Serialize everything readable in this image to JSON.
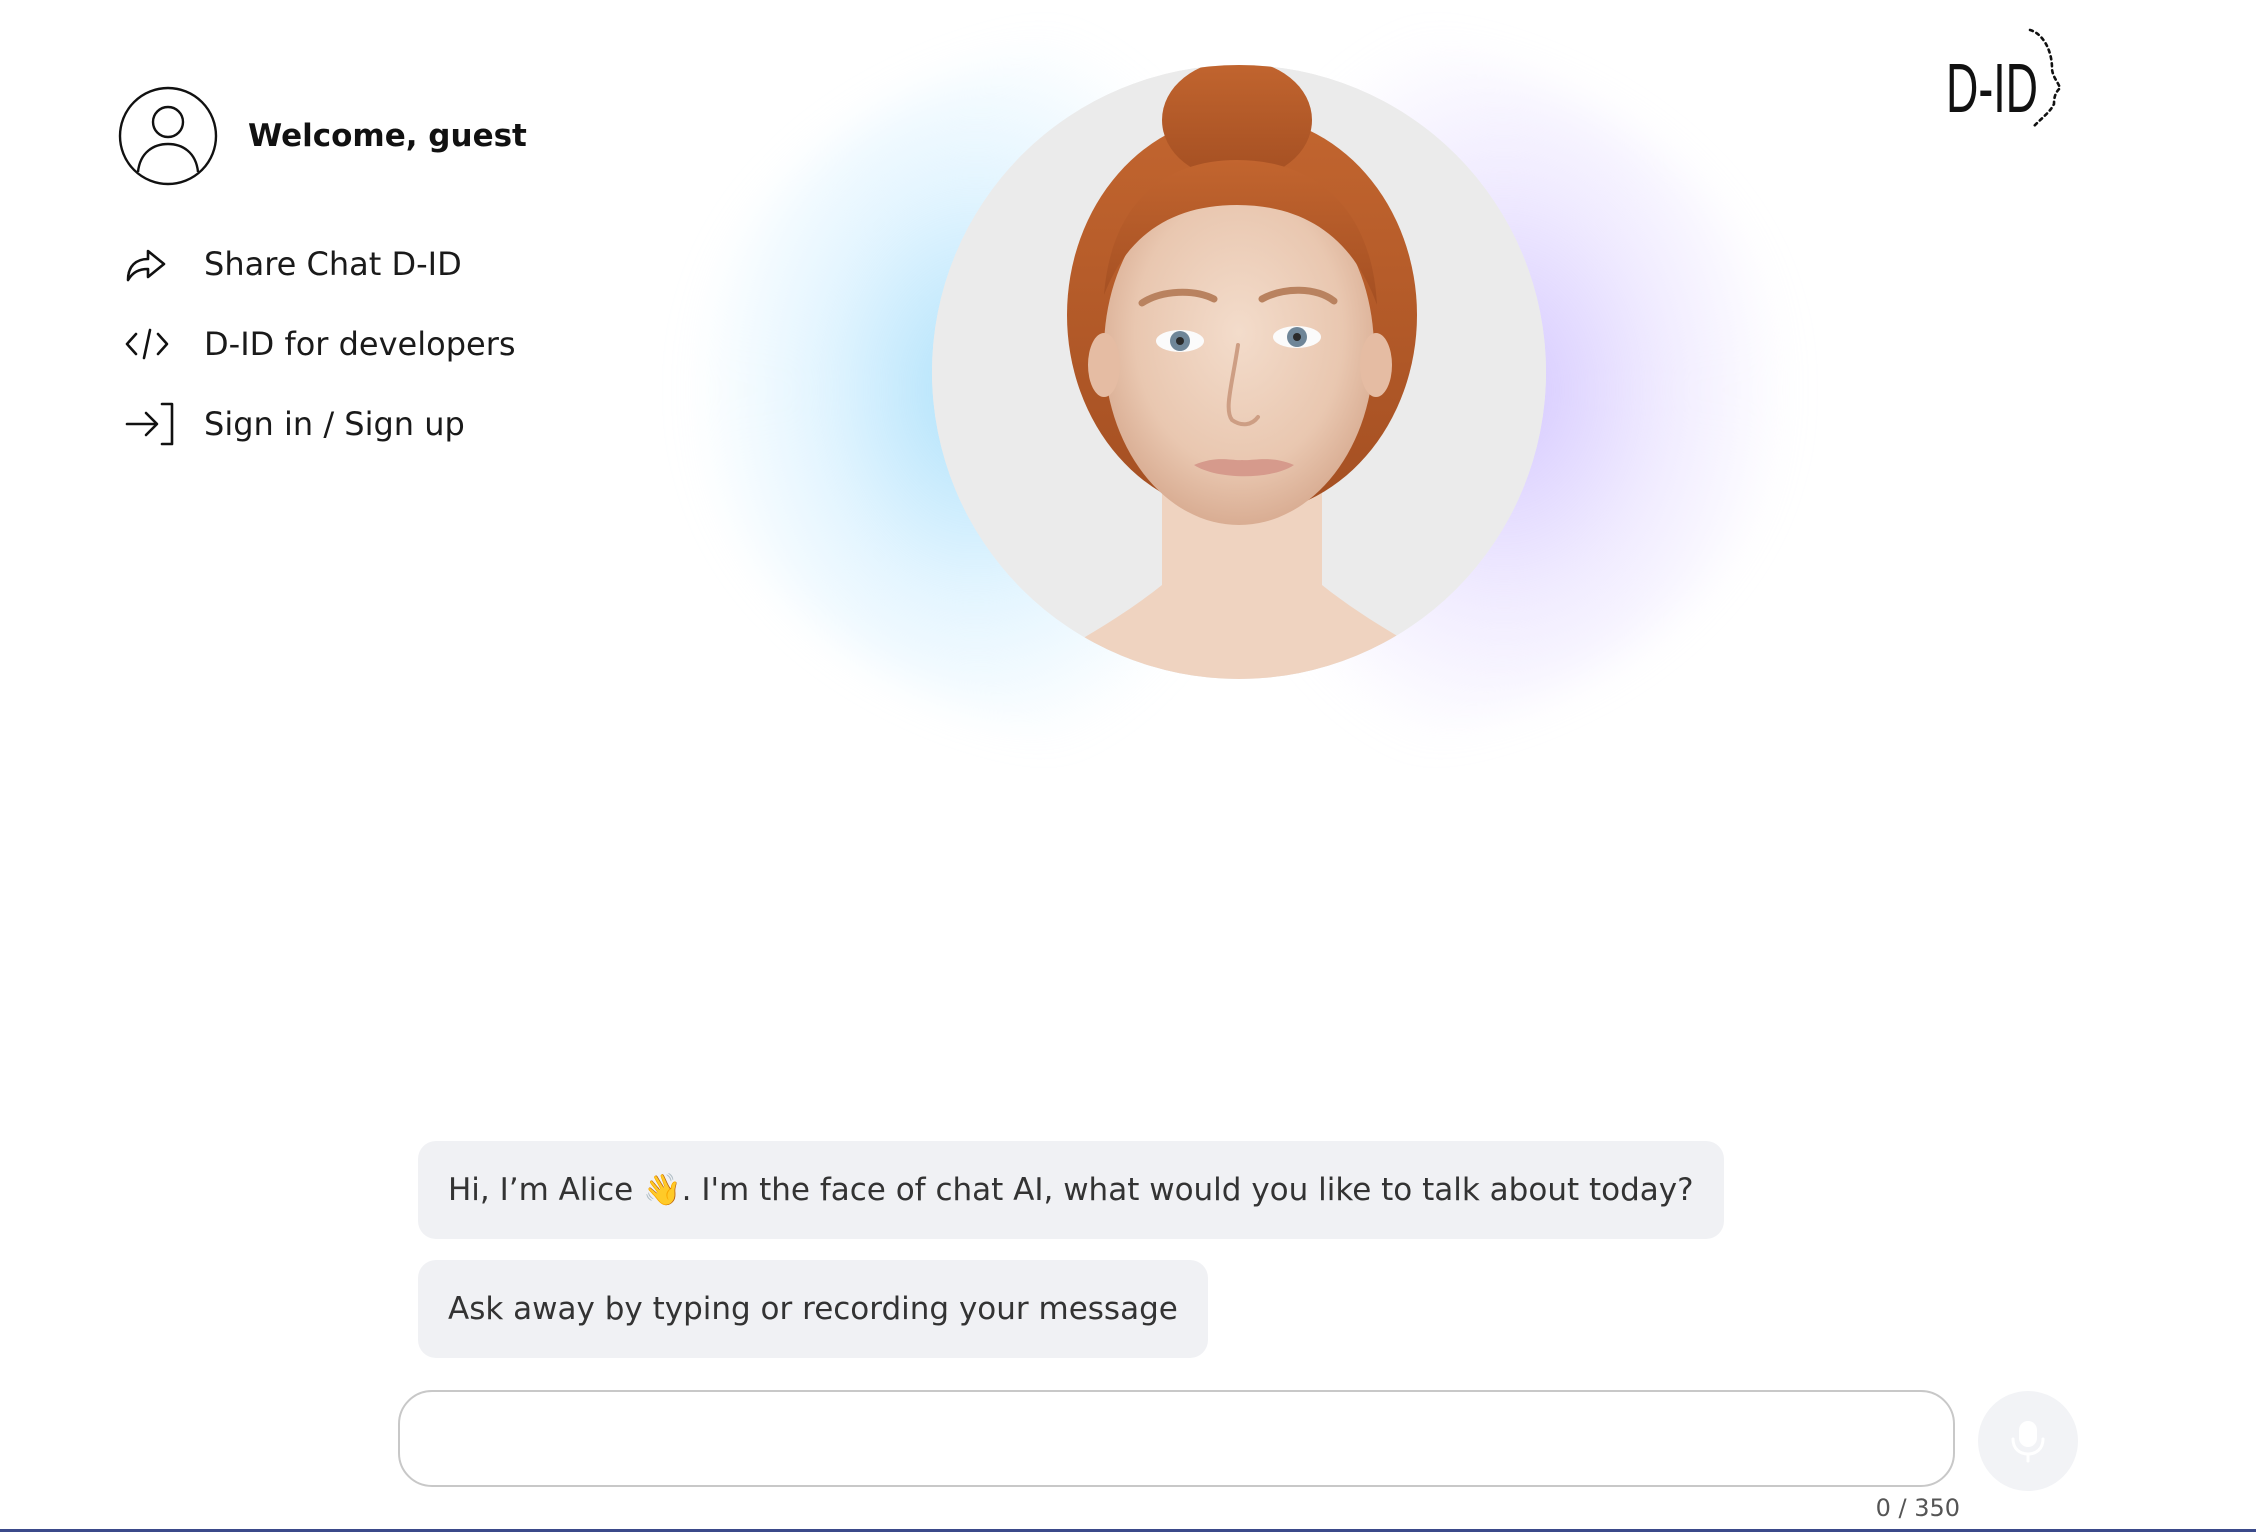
{
  "user": {
    "welcome_text": "Welcome, guest",
    "avatar_icon": "user-circle-icon"
  },
  "sidebar": {
    "items": [
      {
        "label": "Share Chat D-ID",
        "icon": "share-arrow-icon"
      },
      {
        "label": "D-ID for developers",
        "icon": "code-icon"
      },
      {
        "label": "Sign in / Sign up",
        "icon": "sign-in-icon"
      }
    ]
  },
  "logo": {
    "text": "D-ID"
  },
  "chat": {
    "messages": [
      {
        "text": "Hi, I’m Alice 👋. I'm the face of chat AI, what would you like to talk about today?"
      },
      {
        "text": "Ask away by typing or recording your message"
      }
    ],
    "input": {
      "value": "",
      "placeholder": ""
    },
    "char_counter": "0 / 350",
    "mic_icon": "microphone-icon"
  },
  "colors": {
    "bubble_bg": "#f0f1f4",
    "glow_left": "#a0dcfa",
    "glow_right": "#cdbeff",
    "bottom_line": "#3b4a8a"
  }
}
